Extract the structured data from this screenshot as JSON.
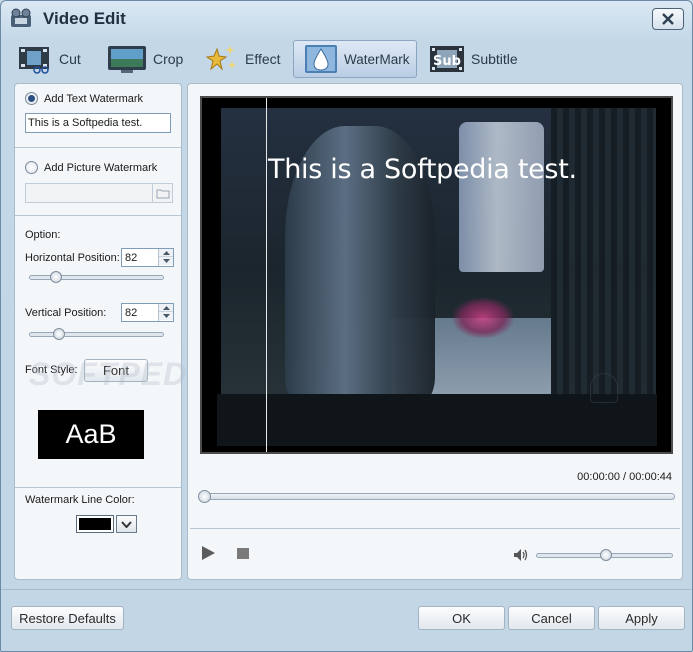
{
  "window": {
    "title": "Video Edit"
  },
  "tabs": [
    {
      "label": "Cut",
      "icon": "film-scissors-icon"
    },
    {
      "label": "Crop",
      "icon": "crop-monitor-icon"
    },
    {
      "label": "Effect",
      "icon": "sparkle-stars-icon"
    },
    {
      "label": "WaterMark",
      "icon": "water-drop-icon",
      "active": true
    },
    {
      "label": "Subtitle",
      "icon": "subtitle-film-icon",
      "icon_text": "Sub"
    }
  ],
  "left_panel": {
    "text_watermark_label": "Add Text Watermark",
    "text_watermark_selected": true,
    "text_watermark_value": "This is a Softpedia test.",
    "picture_watermark_label": "Add Picture Watermark",
    "picture_watermark_value": "",
    "option_label": "Option:",
    "horizontal_label": "Horizontal Position:",
    "horizontal_value": "82",
    "horizontal_slider_level": 0.16,
    "vertical_label": "Vertical Position:",
    "vertical_value": "82",
    "vertical_slider_level": 0.19,
    "font_style_label": "Font Style:",
    "font_button_label": "Font",
    "font_preview_text": "AaB",
    "line_color_label": "Watermark Line Color:",
    "line_color": "#000000"
  },
  "video": {
    "watermark_text": "This is a Softpedia test.",
    "current_time": "00:00:00",
    "time_separator": "/",
    "total_time": "00:00:44",
    "seek_level": 0,
    "volume_level": 0.5
  },
  "footer": {
    "restore_label": "Restore Defaults",
    "ok_label": "OK",
    "cancel_label": "Cancel",
    "apply_label": "Apply"
  },
  "overlay_watermark": "SOFTPEDIA"
}
